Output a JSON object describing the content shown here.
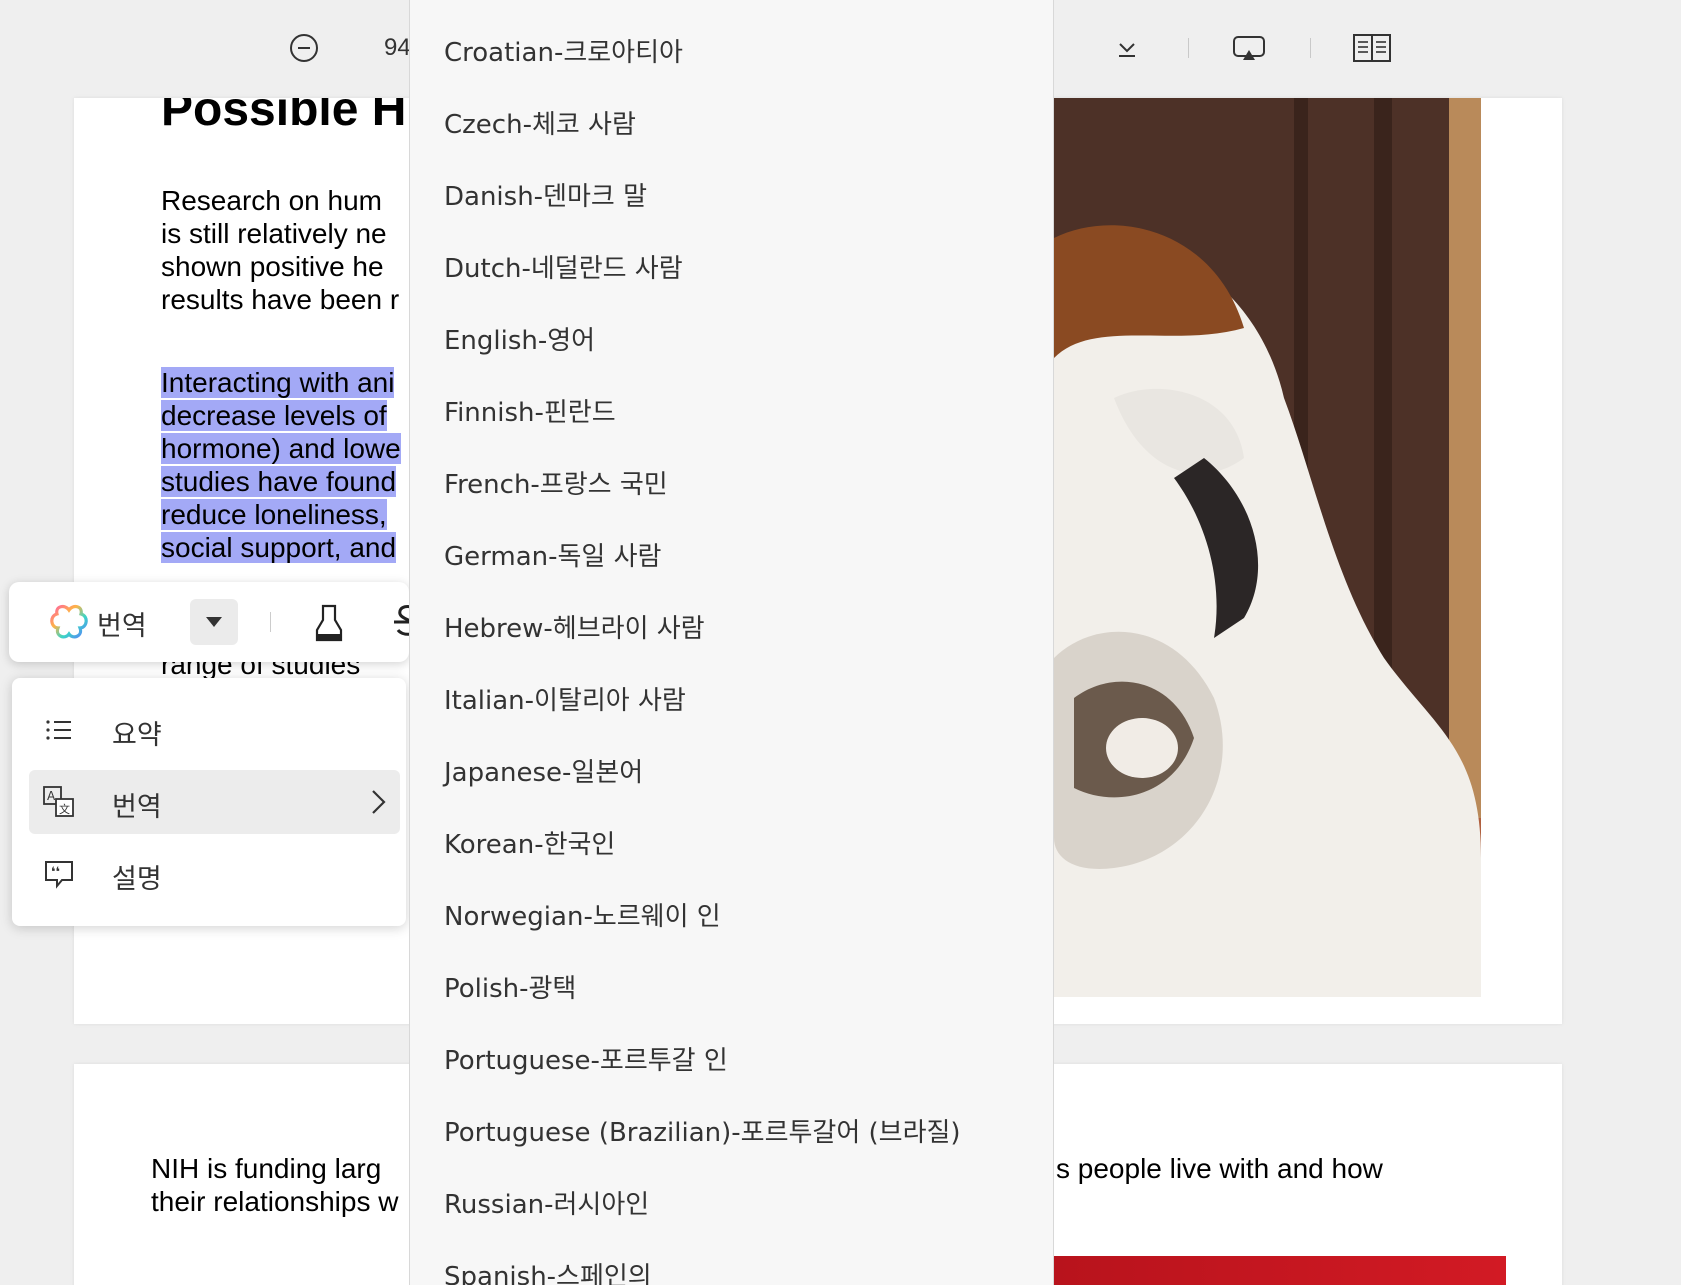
{
  "toolbar": {
    "zoom_value": "94",
    "zoom_out_icon": "minus-circle-icon",
    "download_icon": "download-icon",
    "present_icon": "present-screen-icon",
    "reading_icon": "reading-mode-icon"
  },
  "document": {
    "heading": "Possible H",
    "para1": [
      "Research  on  hum",
      "is still  relatively  ne",
      "shown  positive  he",
      "results have been r"
    ],
    "para2": [
      "Interacting with ani",
      "decrease levels of",
      "hormone) and lowe",
      "studies have found",
      "reduce loneliness,",
      "social support, and"
    ],
    "para3_partial": "range  of  studies",
    "page2_line1_left": "NIH  is  funding  larg",
    "page2_line2_left": "their relationships w",
    "page2_line1_right": "s  people  live  with  and  how"
  },
  "action_bar": {
    "ai_label": "번역",
    "ai_icon": "ai-flower-icon",
    "dropdown_icon": "caret-down-icon",
    "highlighter_icon": "highlighter-icon",
    "strikethrough_icon": "strikethrough-icon"
  },
  "context_menu": {
    "items": [
      {
        "label": "요약",
        "icon": "list-icon"
      },
      {
        "label": "번역",
        "icon": "translate-icon"
      },
      {
        "label": "설명",
        "icon": "explain-icon"
      }
    ]
  },
  "languages": [
    "Croatian-크로아티아",
    "Czech-체코 사람",
    "Danish-덴마크 말",
    "Dutch-네덜란드 사람",
    "English-영어",
    "Finnish-핀란드",
    "French-프랑스 국민",
    "German-독일 사람",
    "Hebrew-헤브라이 사람",
    "Italian-이탈리아 사람",
    "Japanese-일본어",
    "Korean-한국인",
    "Norwegian-노르웨이 인",
    "Polish-광택",
    "Portuguese-포르투갈 인",
    "Portuguese (Brazilian)-포르투갈어 (브라질)",
    "Russian-러시아인",
    "Spanish-스페인의"
  ],
  "colors": {
    "highlight": "#a3a9f6",
    "menu_active": "#ececec",
    "background": "#efefef"
  }
}
